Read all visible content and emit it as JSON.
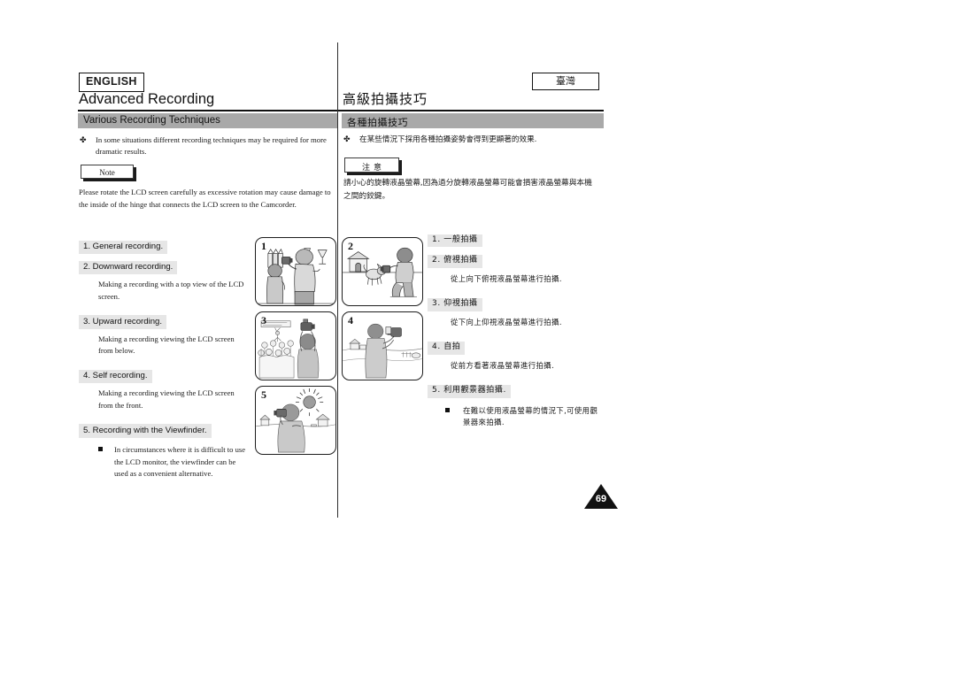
{
  "page": {
    "number": "69",
    "language_tag_left": "ENGLISH",
    "language_tag_right": "臺灣"
  },
  "left_column": {
    "chapter_title": "Advanced Recording",
    "section_title": "Various Recording Techniques",
    "intro_marker": "✤",
    "intro_text": "In some situations different recording techniques may be required for more dramatic results.",
    "note_label": "Note",
    "note_text": "Please rotate the LCD screen carefully as excessive rotation may cause damage to the inside of the hinge that connects the LCD screen to the Camcorder.",
    "items": [
      {
        "label": "1.  General recording.",
        "description": ""
      },
      {
        "label": "2.  Downward recording.",
        "description": "Making a recording with a top view of the LCD screen."
      },
      {
        "label": "3.  Upward recording.",
        "description": "Making a recording viewing the LCD screen from below."
      },
      {
        "label": "4.  Self recording.",
        "description": "Making a recording viewing the LCD screen from the front."
      },
      {
        "label": "5.  Recording with the Viewfinder.",
        "description": "",
        "sub_bullet": "In circumstances where it is difficult to use the LCD monitor, the viewfinder can be used as a convenient alternative."
      }
    ]
  },
  "right_column": {
    "chapter_title": "高級拍攝技巧",
    "section_title": "各種拍攝技巧",
    "intro_marker": "✤",
    "intro_text": "在某些情況下採用各種拍攝姿勢會得到更顯著的效果.",
    "note_label": "注意",
    "note_text": "請小心的旋轉液晶螢幕,因為過分旋轉液晶螢幕可能會損害液晶螢幕與本機之間的鉸鍵。",
    "items": [
      {
        "label": "1. 一般拍攝",
        "description": ""
      },
      {
        "label": "2. 俯視拍攝",
        "description": "從上向下俯視液晶螢幕進行拍攝."
      },
      {
        "label": "3. 仰視拍攝",
        "description": "從下向上仰視液晶螢幕進行拍攝."
      },
      {
        "label": "4. 自拍",
        "description": "從前方看著液晶螢幕進行拍攝."
      },
      {
        "label": "5. 利用觀景器拍攝.",
        "description": "",
        "sub_bullet": "在難以使用液晶螢幕的情況下,可使用觀景器來拍攝."
      }
    ]
  },
  "illustrations": [
    {
      "number": "1",
      "name": "general-recording-illustration"
    },
    {
      "number": "2",
      "name": "downward-recording-illustration"
    },
    {
      "number": "3",
      "name": "upward-recording-illustration"
    },
    {
      "number": "4",
      "name": "self-recording-illustration"
    },
    {
      "number": "5",
      "name": "viewfinder-recording-illustration"
    }
  ],
  "colors": {
    "section_bar": "#a9a9a9",
    "item_highlight": "#e6e6e6",
    "rule": "#111111"
  }
}
